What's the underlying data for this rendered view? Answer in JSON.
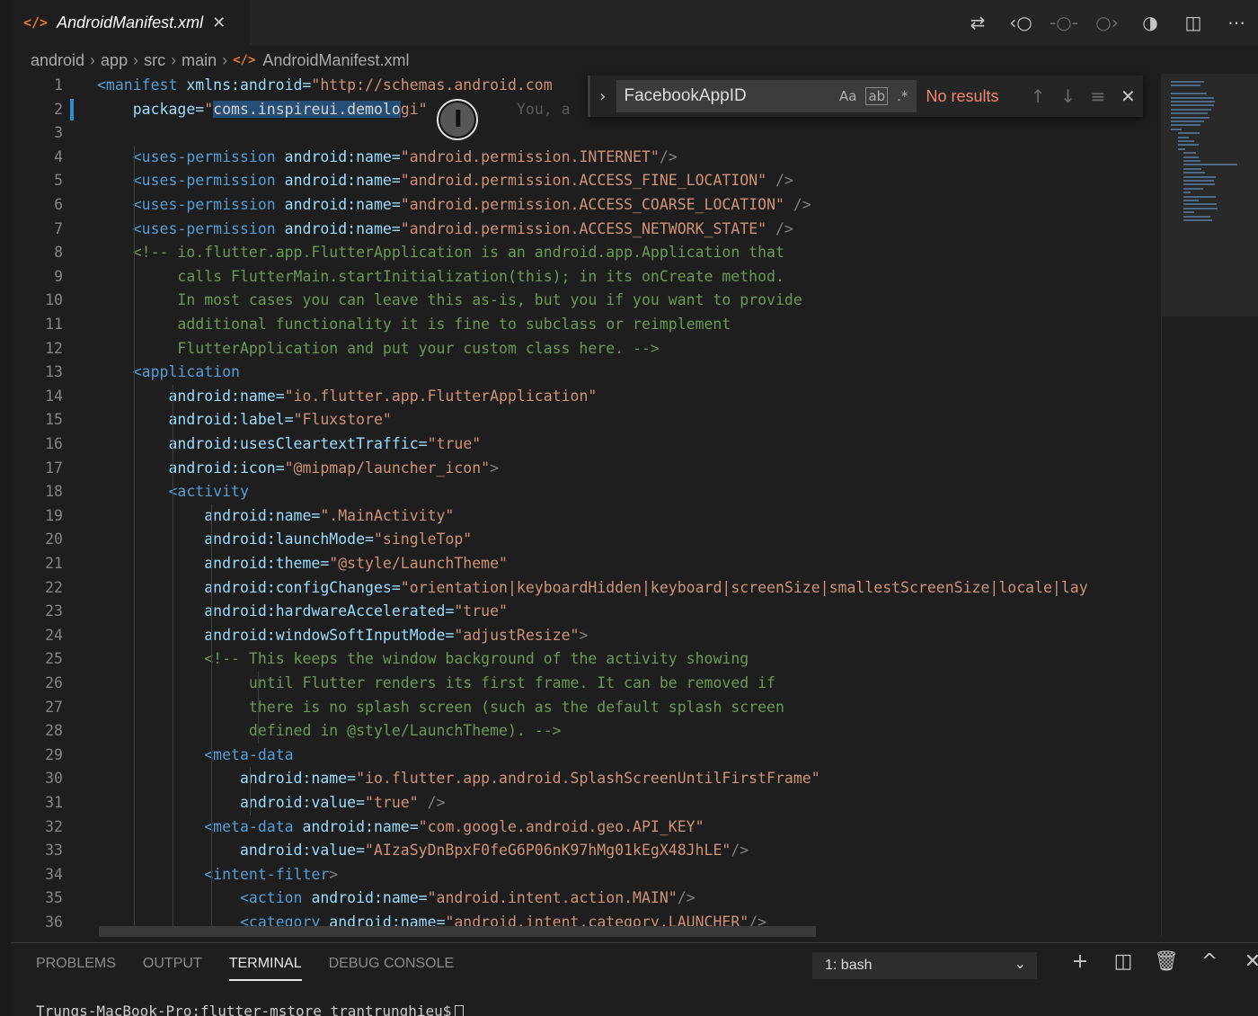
{
  "tab": {
    "icon": "xml-file-icon",
    "title": "AndroidManifest.xml",
    "close": "✕"
  },
  "editor_actions": [
    "⇄",
    "‹○",
    "-○-",
    "○›",
    "◑",
    "◫",
    "⋯"
  ],
  "breadcrumb": [
    "android",
    "app",
    "src",
    "main",
    "AndroidManifest.xml"
  ],
  "breadcrumb_sep": "›",
  "find": {
    "expand": "›",
    "value": "FacebookAppID",
    "match_case": "Aa",
    "whole_word": "ab",
    "regex": ".*",
    "status": "No results",
    "prev": "↑",
    "next": "↓",
    "in_selection": "≡",
    "close": "✕"
  },
  "lines": [
    {
      "n": "1",
      "tokens": [
        [
          "t",
          "<manifest "
        ],
        [
          "a",
          "xmlns:android="
        ],
        [
          "s",
          "\"http://schemas.android.com"
        ]
      ]
    },
    {
      "n": "2",
      "tokens": [
        [
          "",
          "    "
        ],
        [
          "a",
          "package="
        ],
        [
          "s",
          "\""
        ],
        [
          "sel",
          "coms.inspireui.demolo"
        ],
        [
          "s",
          "gi\""
        ],
        [
          "g",
          "          You, a"
        ]
      ]
    },
    {
      "n": "3",
      "tokens": []
    },
    {
      "n": "4",
      "tokens": [
        [
          "",
          "    "
        ],
        [
          "t",
          "<uses-permission "
        ],
        [
          "a",
          "android:name="
        ],
        [
          "s",
          "\"android.permission.INTERNET\""
        ],
        [
          "p",
          "/>"
        ]
      ]
    },
    {
      "n": "5",
      "tokens": [
        [
          "",
          "    "
        ],
        [
          "t",
          "<uses-permission "
        ],
        [
          "a",
          "android:name="
        ],
        [
          "s",
          "\"android.permission.ACCESS_FINE_LOCATION\""
        ],
        [
          "p",
          " />"
        ]
      ]
    },
    {
      "n": "6",
      "tokens": [
        [
          "",
          "    "
        ],
        [
          "t",
          "<uses-permission "
        ],
        [
          "a",
          "android:name="
        ],
        [
          "s",
          "\"android.permission.ACCESS_COARSE_LOCATION\""
        ],
        [
          "p",
          " />"
        ]
      ]
    },
    {
      "n": "7",
      "tokens": [
        [
          "",
          "    "
        ],
        [
          "t",
          "<uses-permission "
        ],
        [
          "a",
          "android:name="
        ],
        [
          "s",
          "\"android.permission.ACCESS_NETWORK_STATE\""
        ],
        [
          "p",
          " />"
        ]
      ]
    },
    {
      "n": "8",
      "tokens": [
        [
          "",
          "    "
        ],
        [
          "c",
          "<!-- io.flutter.app.FlutterApplication is an android.app.Application that"
        ]
      ]
    },
    {
      "n": "9",
      "tokens": [
        [
          "",
          "         "
        ],
        [
          "c",
          "calls FlutterMain.startInitialization(this); in its onCreate method."
        ]
      ]
    },
    {
      "n": "10",
      "tokens": [
        [
          "",
          "         "
        ],
        [
          "c",
          "In most cases you can leave this as-is, but you if you want to provide"
        ]
      ]
    },
    {
      "n": "11",
      "tokens": [
        [
          "",
          "         "
        ],
        [
          "c",
          "additional functionality it is fine to subclass or reimplement"
        ]
      ]
    },
    {
      "n": "12",
      "tokens": [
        [
          "",
          "         "
        ],
        [
          "c",
          "FlutterApplication and put your custom class here. -->"
        ]
      ]
    },
    {
      "n": "13",
      "tokens": [
        [
          "",
          "    "
        ],
        [
          "t",
          "<application"
        ]
      ]
    },
    {
      "n": "14",
      "tokens": [
        [
          "",
          "        "
        ],
        [
          "a",
          "android:name="
        ],
        [
          "s",
          "\"io.flutter.app.FlutterApplication\""
        ]
      ]
    },
    {
      "n": "15",
      "tokens": [
        [
          "",
          "        "
        ],
        [
          "a",
          "android:label="
        ],
        [
          "s",
          "\"Fluxstore\""
        ]
      ]
    },
    {
      "n": "16",
      "tokens": [
        [
          "",
          "        "
        ],
        [
          "a",
          "android:usesCleartextTraffic="
        ],
        [
          "s",
          "\"true\""
        ]
      ]
    },
    {
      "n": "17",
      "tokens": [
        [
          "",
          "        "
        ],
        [
          "a",
          "android:icon="
        ],
        [
          "s",
          "\"@mipmap/launcher_icon\""
        ],
        [
          "p",
          ">"
        ]
      ]
    },
    {
      "n": "18",
      "tokens": [
        [
          "",
          "        "
        ],
        [
          "t",
          "<activity"
        ]
      ]
    },
    {
      "n": "19",
      "tokens": [
        [
          "",
          "            "
        ],
        [
          "a",
          "android:name="
        ],
        [
          "s",
          "\".MainActivity\""
        ]
      ]
    },
    {
      "n": "20",
      "tokens": [
        [
          "",
          "            "
        ],
        [
          "a",
          "android:launchMode="
        ],
        [
          "s",
          "\"singleTop\""
        ]
      ]
    },
    {
      "n": "21",
      "tokens": [
        [
          "",
          "            "
        ],
        [
          "a",
          "android:theme="
        ],
        [
          "s",
          "\"@style/LaunchTheme\""
        ]
      ]
    },
    {
      "n": "22",
      "tokens": [
        [
          "",
          "            "
        ],
        [
          "a",
          "android:configChanges="
        ],
        [
          "s",
          "\"orientation|keyboardHidden|keyboard|screenSize|smallestScreenSize|locale|lay"
        ]
      ]
    },
    {
      "n": "23",
      "tokens": [
        [
          "",
          "            "
        ],
        [
          "a",
          "android:hardwareAccelerated="
        ],
        [
          "s",
          "\"true\""
        ]
      ]
    },
    {
      "n": "24",
      "tokens": [
        [
          "",
          "            "
        ],
        [
          "a",
          "android:windowSoftInputMode="
        ],
        [
          "s",
          "\"adjustResize\""
        ],
        [
          "p",
          ">"
        ]
      ]
    },
    {
      "n": "25",
      "tokens": [
        [
          "",
          "            "
        ],
        [
          "c",
          "<!-- This keeps the window background of the activity showing"
        ]
      ]
    },
    {
      "n": "26",
      "tokens": [
        [
          "",
          "                 "
        ],
        [
          "c",
          "until Flutter renders its first frame. It can be removed if"
        ]
      ]
    },
    {
      "n": "27",
      "tokens": [
        [
          "",
          "                 "
        ],
        [
          "c",
          "there is no splash screen (such as the default splash screen"
        ]
      ]
    },
    {
      "n": "28",
      "tokens": [
        [
          "",
          "                 "
        ],
        [
          "c",
          "defined in @style/LaunchTheme). -->"
        ]
      ]
    },
    {
      "n": "29",
      "tokens": [
        [
          "",
          "            "
        ],
        [
          "t",
          "<meta-data"
        ]
      ]
    },
    {
      "n": "30",
      "tokens": [
        [
          "",
          "                "
        ],
        [
          "a",
          "android:name="
        ],
        [
          "s",
          "\"io.flutter.app.android.SplashScreenUntilFirstFrame\""
        ]
      ]
    },
    {
      "n": "31",
      "tokens": [
        [
          "",
          "                "
        ],
        [
          "a",
          "android:value="
        ],
        [
          "s",
          "\"true\""
        ],
        [
          "p",
          " />"
        ]
      ]
    },
    {
      "n": "32",
      "tokens": [
        [
          "",
          "            "
        ],
        [
          "t",
          "<meta-data "
        ],
        [
          "a",
          "android:name="
        ],
        [
          "s",
          "\"com.google.android.geo.API_KEY\""
        ]
      ]
    },
    {
      "n": "33",
      "tokens": [
        [
          "",
          "                "
        ],
        [
          "a",
          "android:value="
        ],
        [
          "s",
          "\"AIzaSyDnBpxF0feG6P06nK97hMg01kEgX48JhLE\""
        ],
        [
          "p",
          "/>"
        ]
      ]
    },
    {
      "n": "34",
      "tokens": [
        [
          "",
          "            "
        ],
        [
          "t",
          "<intent-filter"
        ],
        [
          "p",
          ">"
        ]
      ]
    },
    {
      "n": "35",
      "tokens": [
        [
          "",
          "                "
        ],
        [
          "t",
          "<action "
        ],
        [
          "a",
          "android:name="
        ],
        [
          "s",
          "\"android.intent.action.MAIN\""
        ],
        [
          "p",
          "/>"
        ]
      ]
    },
    {
      "n": "36",
      "tokens": [
        [
          "",
          "                "
        ],
        [
          "t",
          "<category "
        ],
        [
          "a",
          "android:name="
        ],
        [
          "s",
          "\"android.intent.category.LAUNCHER\""
        ],
        [
          "p",
          "/>"
        ]
      ]
    }
  ],
  "panel": {
    "tabs": [
      "PROBLEMS",
      "OUTPUT",
      "TERMINAL",
      "DEBUG CONSOLE"
    ],
    "active_tab": "TERMINAL",
    "terminal_select": "1: bash",
    "terminal_select_arrow": "⌄",
    "actions": [
      "+",
      "◫",
      "🗑",
      "^",
      "✕"
    ],
    "prompt": "Trungs-MacBook-Pro:flutter-mstore trantrunghieu$"
  }
}
